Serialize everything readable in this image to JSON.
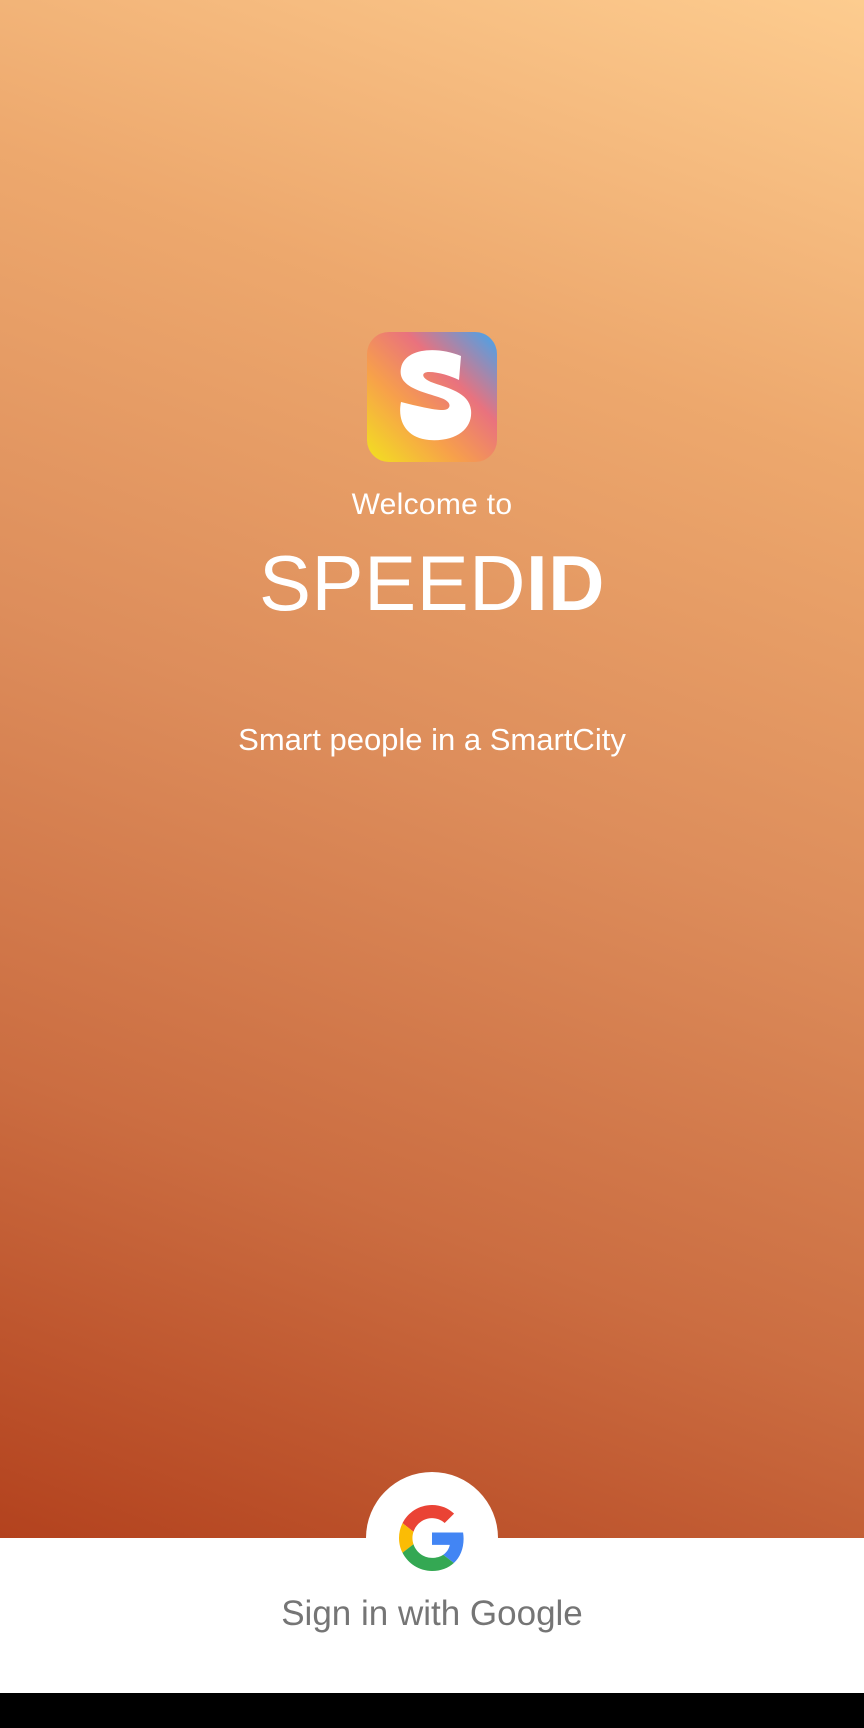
{
  "welcome": {
    "intro_text": "Welcome to",
    "brand_regular": "SPEED",
    "brand_bold": "ID",
    "tagline": "Smart people in a SmartCity"
  },
  "logo": {
    "icon": "speedid-logo-icon",
    "letter": "S"
  },
  "signin": {
    "icon": "google-g-icon",
    "label": "Sign in with Google"
  },
  "colors": {
    "gradient_top": "#fdcc8f",
    "gradient_bottom": "#b3421e",
    "panel": "#ffffff",
    "signin_text": "#757575",
    "google_blue": "#4285F4",
    "google_red": "#EA4335",
    "google_yellow": "#FBBC05",
    "google_green": "#34A853"
  }
}
